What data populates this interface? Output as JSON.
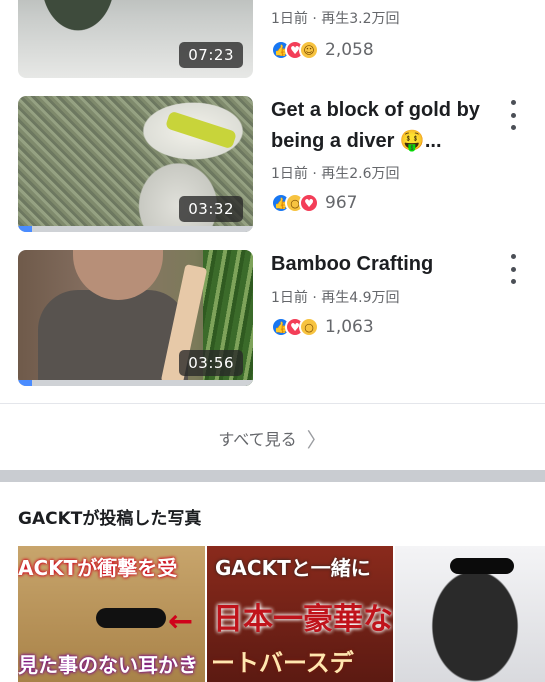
{
  "videos": [
    {
      "title": "",
      "meta": "1日前 · 再生3.2万回",
      "duration": "07:23",
      "reactions": [
        "like-icon",
        "love-icon",
        "haha-icon"
      ],
      "reaction_count": "2,058",
      "progress": 0
    },
    {
      "title": "Get a block of gold by being a diver 🤑...",
      "meta": "1日前 · 再生2.6万回",
      "duration": "03:32",
      "reactions": [
        "like-icon",
        "wow-icon",
        "love-icon"
      ],
      "reaction_count": "967",
      "progress": 0.06
    },
    {
      "title": "Bamboo Crafting",
      "meta": "1日前 · 再生4.9万回",
      "duration": "03:56",
      "reactions": [
        "like-icon",
        "love-icon",
        "wow-icon"
      ],
      "reaction_count": "1,063",
      "progress": 0.06
    }
  ],
  "see_all": "すべて見る",
  "photos_section": {
    "title": "GACKTが投稿した写真",
    "photo1_top": "ACKTが衝撃を受",
    "photo1_bottom": "見た事のない耳かき",
    "photo2_top": "GACKTと一緒に",
    "photo2_mid": "日本一豪華な",
    "photo2_bottom": "ートバースデ"
  },
  "colors": {
    "like": "#1877f2",
    "love": "#f33e58",
    "wow": "#f7c340",
    "progress": "#4a8cff"
  }
}
